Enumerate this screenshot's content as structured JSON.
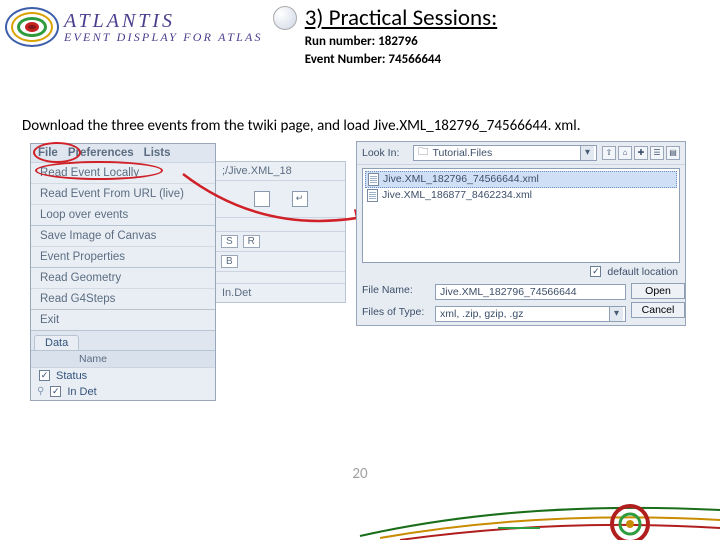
{
  "branding": {
    "line1": "ATLANTIS",
    "line2": "EVENT DISPLAY FOR ATLAS"
  },
  "header": {
    "title": "3) Practical Sessions:",
    "run_label": "Run number: 182796",
    "event_label": "Event Number: 74566644"
  },
  "instruction": "Download the three events from the twiki page, and load Jive.XML_182796_74566644. xml.",
  "menu": {
    "bar": {
      "file": "File",
      "preferences": "Preferences",
      "lists": "Lists"
    },
    "items": [
      "Read Event Locally",
      "Read Event From URL (live)",
      "Loop over events",
      "Save Image of Canvas",
      "Event Properties",
      "Read Geometry",
      "Read G4Steps",
      "Exit"
    ],
    "data_tab": "Data",
    "col_blank": " ",
    "col_name": "Name",
    "status_row": "Status",
    "indet_row": "In Det"
  },
  "center": {
    "path": ";/Jive.XML_18",
    "arrow_icon": "↵",
    "s": "S",
    "r": "R",
    "b": "B",
    "indet": "In.Det"
  },
  "dialog": {
    "lookin_label": "Look In:",
    "lookin_value": "Tutorial.Files",
    "files": [
      "Jive.XML_182796_74566644.xml",
      "Jive.XML_186877_8462234.xml"
    ],
    "default_loc": "default location",
    "filename_label": "File Name:",
    "filename_value": "Jive.XML_182796_74566644",
    "filetype_label": "Files of Type:",
    "filetype_value": "xml, .zip, gzip, .gz",
    "open": "Open",
    "cancel": "Cancel"
  },
  "page_number": "20"
}
